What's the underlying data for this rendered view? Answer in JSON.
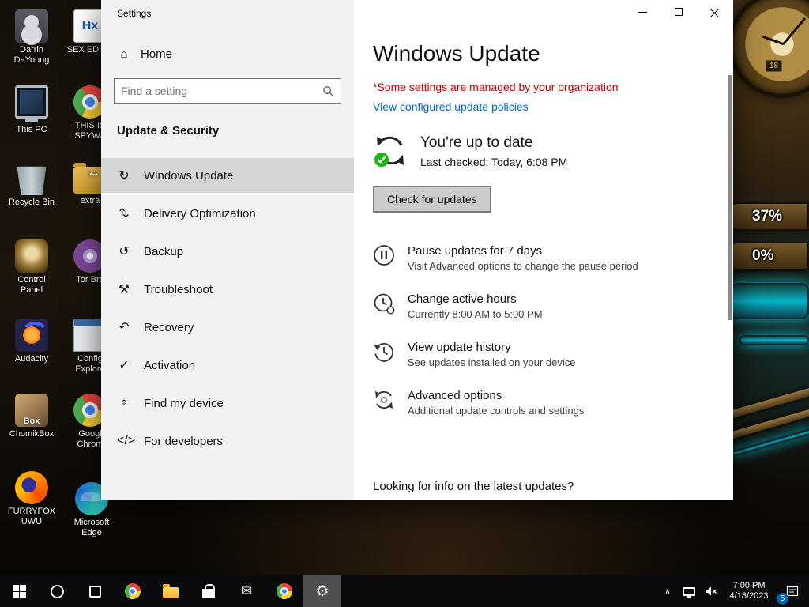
{
  "desktop": {
    "icons": [
      {
        "label": "Darrin DeYoung"
      },
      {
        "label": "SEX EDITO",
        "icon_text": "Hx"
      },
      {
        "label": "This PC"
      },
      {
        "label": "THIS IS SPYWA"
      },
      {
        "label": "Recycle Bin"
      },
      {
        "label": "extra"
      },
      {
        "label": "Control Panel"
      },
      {
        "label": "Tor Bro"
      },
      {
        "label": "Audacity"
      },
      {
        "label": "Config Explore"
      },
      {
        "label": "ChomikBox",
        "icon_text": "Box"
      },
      {
        "label": "Googl Chrom"
      },
      {
        "label": "FURRYFOX UWU"
      },
      {
        "label": "Microsoft Edge"
      }
    ]
  },
  "widgets": {
    "clock_number": "18",
    "gauge1": "37%",
    "gauge2": "0%"
  },
  "settings": {
    "window_title": "Settings",
    "nav": {
      "home_label": "Home",
      "home_glyph": "⌂",
      "search_placeholder": "Find a setting",
      "section_title": "Update & Security",
      "items": [
        {
          "label": "Windows Update",
          "glyph": "↻"
        },
        {
          "label": "Delivery Optimization",
          "glyph": "⇅"
        },
        {
          "label": "Backup",
          "glyph": "↺"
        },
        {
          "label": "Troubleshoot",
          "glyph": "⚒"
        },
        {
          "label": "Recovery",
          "glyph": "↶"
        },
        {
          "label": "Activation",
          "glyph": "✓"
        },
        {
          "label": "Find my device",
          "glyph": "⌖"
        },
        {
          "label": "For developers",
          "glyph": "</>"
        }
      ]
    },
    "content": {
      "title": "Windows Update",
      "org_notice": "*Some settings are managed by your organization",
      "policy_link": "View configured update policies",
      "status_title": "You're up to date",
      "status_subtitle": "Last checked: Today, 6:08 PM",
      "check_button": "Check for updates",
      "options": [
        {
          "title": "Pause updates for 7 days",
          "subtitle": "Visit Advanced options to change the pause period"
        },
        {
          "title": "Change active hours",
          "subtitle": "Currently 8:00 AM to 5:00 PM"
        },
        {
          "title": "View update history",
          "subtitle": "See updates installed on your device"
        },
        {
          "title": "Advanced options",
          "subtitle": "Additional update controls and settings"
        }
      ],
      "footer_question": "Looking for info on the latest updates?"
    }
  },
  "taskbar": {
    "time": "7:00 PM",
    "date": "4/18/2023",
    "notification_badge": "5"
  },
  "colors": {
    "accent_link": "#0066cc",
    "warning_red": "#c50000",
    "status_green": "#1db510"
  }
}
